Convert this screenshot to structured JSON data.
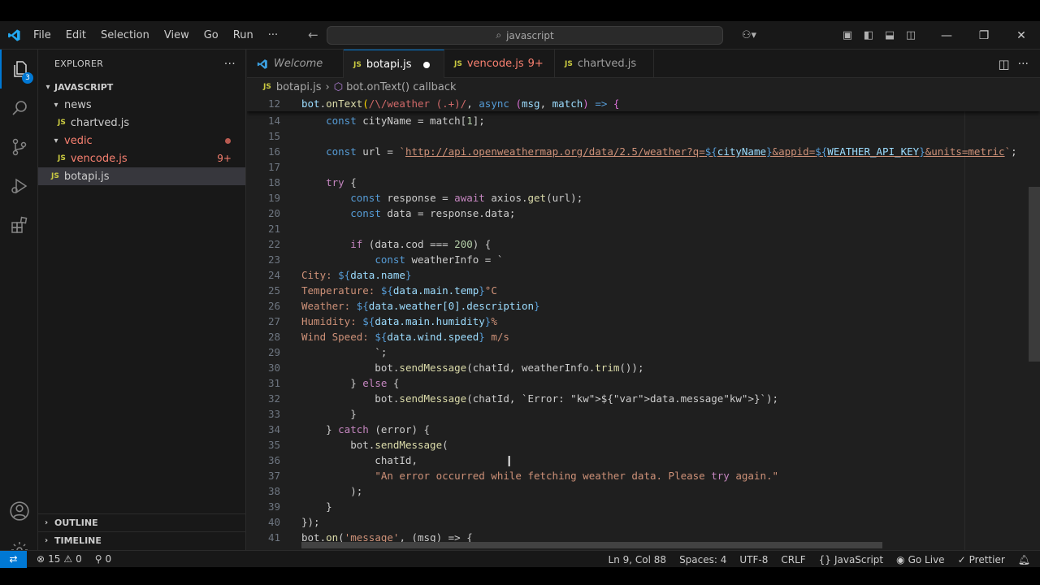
{
  "menu": [
    "File",
    "Edit",
    "Selection",
    "View",
    "Go",
    "Run",
    "···"
  ],
  "search": {
    "label": "javascript"
  },
  "activity": {
    "explorer_badge": "3"
  },
  "explorer": {
    "title": "EXPLORER",
    "root": "JAVASCRIPT",
    "items": [
      {
        "type": "folder",
        "label": "news",
        "indent": 1
      },
      {
        "type": "file",
        "label": "chartved.js",
        "indent": 2
      },
      {
        "type": "folder",
        "label": "vedic",
        "indent": 1
      },
      {
        "type": "file",
        "label": "vencode.js",
        "indent": 2,
        "badge": "9+"
      },
      {
        "type": "file",
        "label": "botapi.js",
        "indent": 1
      }
    ],
    "outline": "OUTLINE",
    "timeline": "TIMELINE"
  },
  "tabs": [
    {
      "label": "Welcome",
      "icon": "vscode-icon"
    },
    {
      "label": "botapi.js",
      "icon": "js",
      "active": true
    },
    {
      "label": "vencode.js",
      "icon": "js",
      "badge": "9+"
    },
    {
      "label": "chartved.js",
      "icon": "js"
    }
  ],
  "breadcrumb": {
    "file": "botapi.js",
    "symbol": "bot.onText() callback"
  },
  "editor": {
    "line_numbers": [
      "12",
      "14",
      "15",
      "16",
      "17",
      "18",
      "19",
      "20",
      "21",
      "22",
      "23",
      "24",
      "25",
      "26",
      "27",
      "28",
      "29",
      "30",
      "31",
      "32",
      "33",
      "34",
      "35",
      "36",
      "37",
      "38",
      "39",
      "40",
      "41"
    ],
    "code": {
      "l12": "bot.onText(/\\/weather (.+)/, async (msg, match) => {",
      "l14": "    const cityName = match[1];",
      "l16": "    const url = `http://api.openweathermap.org/data/2.5/weather?q=${cityName}&appid=${WEATHER_API_KEY}&units=metric`;",
      "l18": "    try {",
      "l19": "        const response = await axios.get(url);",
      "l20": "        const data = response.data;",
      "l22": "        if (data.cod === 200) {",
      "l23": "            const weatherInfo = `",
      "l24": "City: ${data.name}",
      "l25": "Temperature: ${data.main.temp}°C",
      "l26": "Weather: ${data.weather[0].description}",
      "l27": "Humidity: ${data.main.humidity}%",
      "l28": "Wind Speed: ${data.wind.speed} m/s",
      "l29": "            `;",
      "l30": "            bot.sendMessage(chatId, weatherInfo.trim());",
      "l31": "        } else {",
      "l32": "            bot.sendMessage(chatId, `Error: ${data.message}`);",
      "l33": "        }",
      "l34": "    } catch (error) {",
      "l35": "        bot.sendMessage(",
      "l36": "            chatId,",
      "l37": "            \"An error occurred while fetching weather data. Please try again.\"",
      "l38": "        );",
      "l39": "    }",
      "l40": "});",
      "l41": "bot.on('message', (msg) => {"
    }
  },
  "status": {
    "errors": "15",
    "warnings": "0",
    "ports": "0",
    "position": "Ln 9, Col 88",
    "spaces": "Spaces: 4",
    "encoding": "UTF-8",
    "eol": "CRLF",
    "language": "JavaScript",
    "live": "Go Live",
    "prettier": "Prettier"
  },
  "colors": {
    "accent": "#0078d4",
    "background": "#1f1f1f",
    "sidebar": "#181818",
    "error": "#f88070"
  }
}
